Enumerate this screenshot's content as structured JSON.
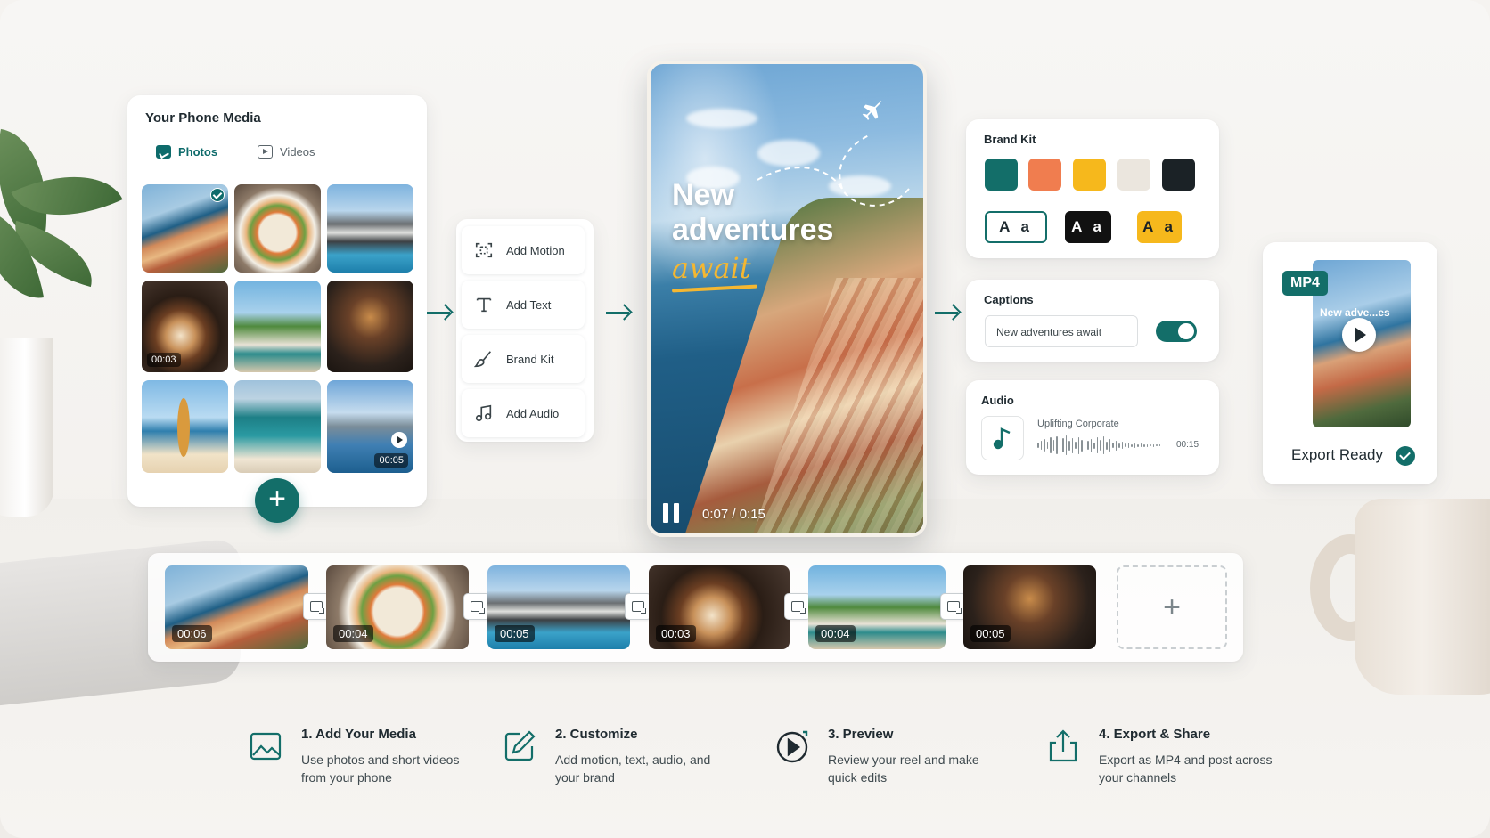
{
  "media_panel": {
    "title": "Your Phone Media",
    "tabs": [
      {
        "label": "Photos",
        "active": true
      },
      {
        "label": "Videos",
        "active": false
      }
    ],
    "items": [
      {
        "scene": "coastal-village",
        "selected": true,
        "duration": ""
      },
      {
        "scene": "salad-bowl",
        "selected": false,
        "duration": ""
      },
      {
        "scene": "modern-house",
        "selected": false,
        "duration": ""
      },
      {
        "scene": "latte-pour",
        "selected": false,
        "duration": "00:03"
      },
      {
        "scene": "van-palm-beach",
        "selected": false,
        "duration": ""
      },
      {
        "scene": "cafe-interior",
        "selected": false,
        "duration": ""
      },
      {
        "scene": "surfboard-beach",
        "selected": false,
        "duration": ""
      },
      {
        "scene": "shop-front",
        "selected": false,
        "duration": ""
      },
      {
        "scene": "pier-sea",
        "selected": false,
        "duration": "00:05",
        "video": true
      }
    ],
    "add_button_icon": "plus-icon"
  },
  "tools": [
    {
      "label": "Add Motion",
      "icon": "motion-frame-icon"
    },
    {
      "label": "Add Text",
      "icon": "text-icon"
    },
    {
      "label": "Brand Kit",
      "icon": "brush-icon"
    },
    {
      "label": "Add Audio",
      "icon": "music-note-icon"
    }
  ],
  "preview": {
    "headline_line1": "New",
    "headline_line2": "adventures",
    "headline_script": "await",
    "time": "0:07 / 0:15",
    "playback_progress": 0.467
  },
  "brand_kit": {
    "title": "Brand Kit",
    "colors": [
      "#136e69",
      "#f07d4f",
      "#f6b81c",
      "#ebe6de",
      "#1b2226"
    ],
    "fonts": [
      {
        "label": "A a",
        "style": "outline"
      },
      {
        "label": "A a",
        "style": "dark"
      },
      {
        "label": "A a",
        "style": "yellow"
      }
    ]
  },
  "captions": {
    "title": "Captions",
    "value": "New adventures await",
    "enabled": true
  },
  "audio": {
    "title": "Audio",
    "track": "Uplifting Corporate",
    "duration": "00:15"
  },
  "export": {
    "format": "MP4",
    "label": "Export Ready",
    "thumb_text": "New adve...es"
  },
  "timeline": {
    "clips": [
      {
        "scene": "coastal-village",
        "duration": "00:06"
      },
      {
        "scene": "salad-bowl",
        "duration": "00:04"
      },
      {
        "scene": "modern-house",
        "duration": "00:05"
      },
      {
        "scene": "latte-pour",
        "duration": "00:03"
      },
      {
        "scene": "van-palm-beach",
        "duration": "00:04"
      },
      {
        "scene": "cafe-interior",
        "duration": "00:05"
      }
    ],
    "add_label": "+"
  },
  "steps": [
    {
      "title": "1. Add Your Media",
      "desc": "Use photos and short videos from your phone",
      "icon": "image-icon"
    },
    {
      "title": "2. Customize",
      "desc": "Add motion, text, audio, and your brand",
      "icon": "edit-icon"
    },
    {
      "title": "3. Preview",
      "desc": "Review your reel and make quick edits",
      "icon": "play-circle-icon"
    },
    {
      "title": "4. Export & Share",
      "desc": "Export as MP4 and post across your channels",
      "icon": "share-icon"
    }
  ],
  "theme": {
    "accent": "#136e69"
  }
}
